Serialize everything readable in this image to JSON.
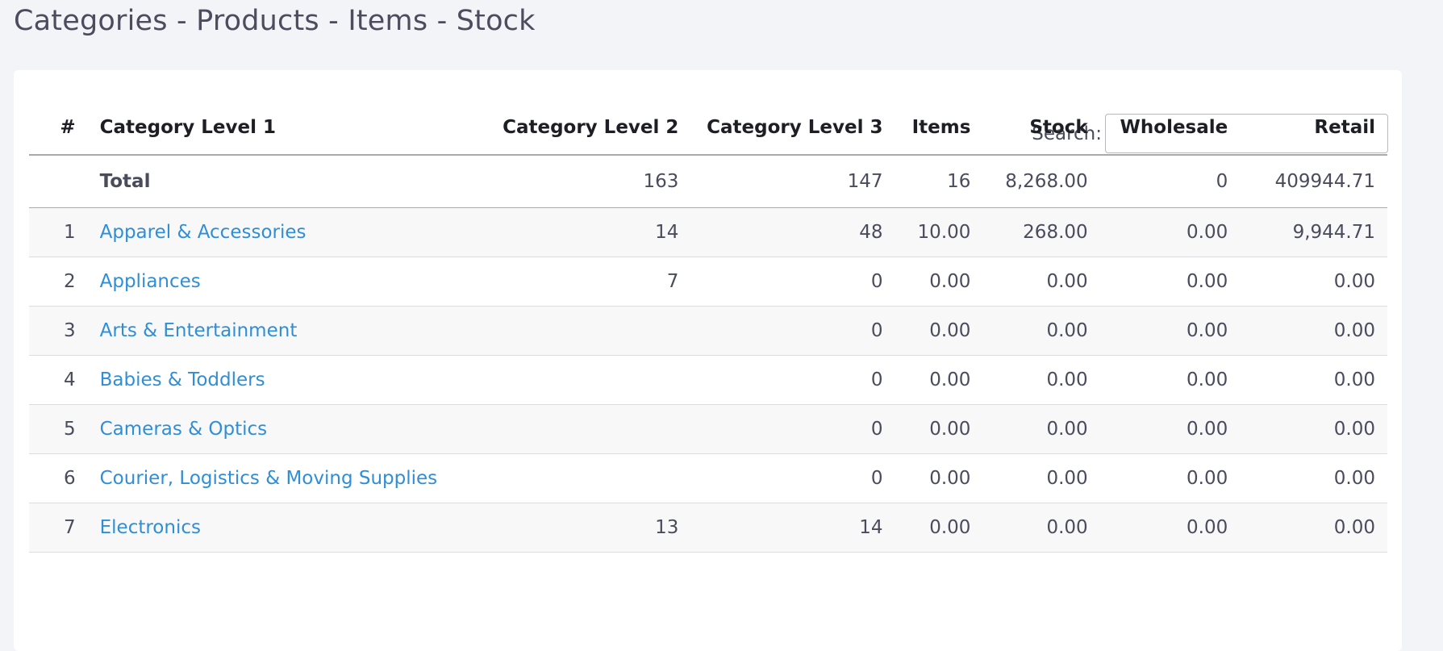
{
  "page": {
    "title": "Categories - Products - Items - Stock"
  },
  "search": {
    "label": "Search:",
    "value": ""
  },
  "table": {
    "columns": {
      "index": "#",
      "cat1": "Category Level 1",
      "cat2": "Category Level 2",
      "cat3": "Category Level 3",
      "items": "Items",
      "stock": "Stock",
      "wholesale": "Wholesale",
      "retail": "Retail"
    },
    "total": {
      "label": "Total",
      "cat2": "163",
      "cat3": "147",
      "items": "16",
      "stock": "8,268.00",
      "wholesale": "0",
      "retail": "409944.71"
    },
    "rows": [
      {
        "index": "1",
        "cat1": "Apparel & Accessories",
        "cat2": "14",
        "cat3": "48",
        "items": "10.00",
        "stock": "268.00",
        "wholesale": "0.00",
        "retail": "9,944.71"
      },
      {
        "index": "2",
        "cat1": "Appliances",
        "cat2": "7",
        "cat3": "0",
        "items": "0.00",
        "stock": "0.00",
        "wholesale": "0.00",
        "retail": "0.00"
      },
      {
        "index": "3",
        "cat1": "Arts & Entertainment",
        "cat2": "",
        "cat3": "0",
        "items": "0.00",
        "stock": "0.00",
        "wholesale": "0.00",
        "retail": "0.00"
      },
      {
        "index": "4",
        "cat1": "Babies & Toddlers",
        "cat2": "",
        "cat3": "0",
        "items": "0.00",
        "stock": "0.00",
        "wholesale": "0.00",
        "retail": "0.00"
      },
      {
        "index": "5",
        "cat1": "Cameras & Optics",
        "cat2": "",
        "cat3": "0",
        "items": "0.00",
        "stock": "0.00",
        "wholesale": "0.00",
        "retail": "0.00"
      },
      {
        "index": "6",
        "cat1": "Courier, Logistics & Moving Supplies",
        "cat2": "",
        "cat3": "0",
        "items": "0.00",
        "stock": "0.00",
        "wholesale": "0.00",
        "retail": "0.00"
      },
      {
        "index": "7",
        "cat1": "Electronics",
        "cat2": "13",
        "cat3": "14",
        "items": "0.00",
        "stock": "0.00",
        "wholesale": "0.00",
        "retail": "0.00"
      }
    ]
  },
  "colors": {
    "link": "#2f8ed6",
    "page_bg": "#f3f4f7",
    "card_bg": "#ffffff",
    "stripe": "#f8f8f9"
  }
}
